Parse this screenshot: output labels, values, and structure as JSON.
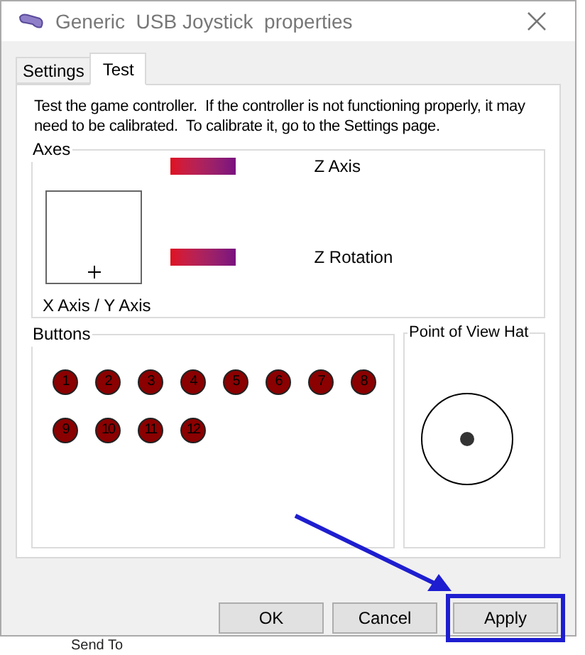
{
  "window": {
    "title": "Generic  USB Joystick  properties"
  },
  "tabs": [
    {
      "label": "Settings",
      "selected": false
    },
    {
      "label": "Test",
      "selected": true
    }
  ],
  "instructions": "Test the game controller.  If the controller is not functioning properly, it may need to be calibrated.  To calibrate it, go to the Settings page.",
  "axes": {
    "title": "Axes",
    "xy_label": "X Axis / Y Axis",
    "bars": [
      {
        "label": "Z Axis"
      },
      {
        "label": "Z Rotation"
      }
    ]
  },
  "buttons": {
    "title": "Buttons",
    "items": [
      {
        "label": "1",
        "pressed": false
      },
      {
        "label": "2",
        "pressed": false
      },
      {
        "label": "3",
        "pressed": false
      },
      {
        "label": "4",
        "pressed": false
      },
      {
        "label": "5",
        "pressed": false
      },
      {
        "label": "6",
        "pressed": false
      },
      {
        "label": "7",
        "pressed": false
      },
      {
        "label": "8",
        "pressed": false
      },
      {
        "label": "9",
        "pressed": false
      },
      {
        "label": "10",
        "pressed": false
      },
      {
        "label": "11",
        "pressed": false
      },
      {
        "label": "12",
        "pressed": false
      }
    ]
  },
  "pov_hat": {
    "title": "Point of View Hat"
  },
  "dialog_buttons": [
    {
      "label": "OK",
      "highlighted": false
    },
    {
      "label": "Cancel",
      "highlighted": false
    },
    {
      "label": "Apply",
      "highlighted": true
    }
  ],
  "background_text": "Send To"
}
